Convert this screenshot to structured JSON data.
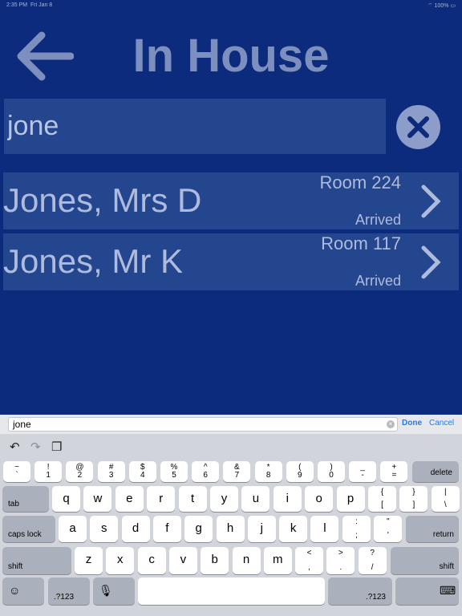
{
  "status_bar": {
    "time": "2:35 PM",
    "date": "Fri Jan 8",
    "battery": "100%"
  },
  "header": {
    "title": "In House"
  },
  "search": {
    "value": "jone",
    "placeholder": ""
  },
  "results": [
    {
      "name": "Jones, Mrs D",
      "room": "Room 224",
      "status": "Arrived"
    },
    {
      "name": "Jones, Mr K",
      "room": "Room 117",
      "status": "Arrived"
    }
  ],
  "keyboard": {
    "accessory": {
      "field_value": "jone",
      "done_label": "Done",
      "cancel_label": "Cancel"
    },
    "number_row": [
      {
        "top": "~",
        "bottom": "`"
      },
      {
        "top": "!",
        "bottom": "1"
      },
      {
        "top": "@",
        "bottom": "2"
      },
      {
        "top": "#",
        "bottom": "3"
      },
      {
        "top": "$",
        "bottom": "4"
      },
      {
        "top": "%",
        "bottom": "5"
      },
      {
        "top": "^",
        "bottom": "6"
      },
      {
        "top": "&",
        "bottom": "7"
      },
      {
        "top": "*",
        "bottom": "8"
      },
      {
        "top": "(",
        "bottom": "9"
      },
      {
        "top": ")",
        "bottom": "0"
      },
      {
        "top": "_",
        "bottom": "-"
      },
      {
        "top": "+",
        "bottom": "="
      }
    ],
    "delete_label": "delete",
    "tab_label": "tab",
    "row_q": [
      "q",
      "w",
      "e",
      "r",
      "t",
      "y",
      "u",
      "i",
      "o",
      "p"
    ],
    "row_q_extra": [
      {
        "top": "{",
        "bottom": "["
      },
      {
        "top": "}",
        "bottom": "]"
      },
      {
        "top": "|",
        "bottom": "\\"
      }
    ],
    "caps_label": "caps lock",
    "row_a": [
      "a",
      "s",
      "d",
      "f",
      "g",
      "h",
      "j",
      "k",
      "l"
    ],
    "row_a_extra": [
      {
        "top": ":",
        "bottom": ";"
      },
      {
        "top": "\"",
        "bottom": "'"
      }
    ],
    "return_label": "return",
    "shift_label": "shift",
    "row_z": [
      "z",
      "x",
      "c",
      "v",
      "b",
      "n",
      "m"
    ],
    "row_z_extra": [
      {
        "top": "<",
        "bottom": ","
      },
      {
        "top": ">",
        "bottom": "."
      },
      {
        "top": "?",
        "bottom": "/"
      }
    ],
    "numbers_label": ".?123"
  },
  "colors": {
    "background": "#0c2b7d",
    "row": "#24468f",
    "text": "#aebbdd",
    "accent": "#1a7cf0"
  }
}
